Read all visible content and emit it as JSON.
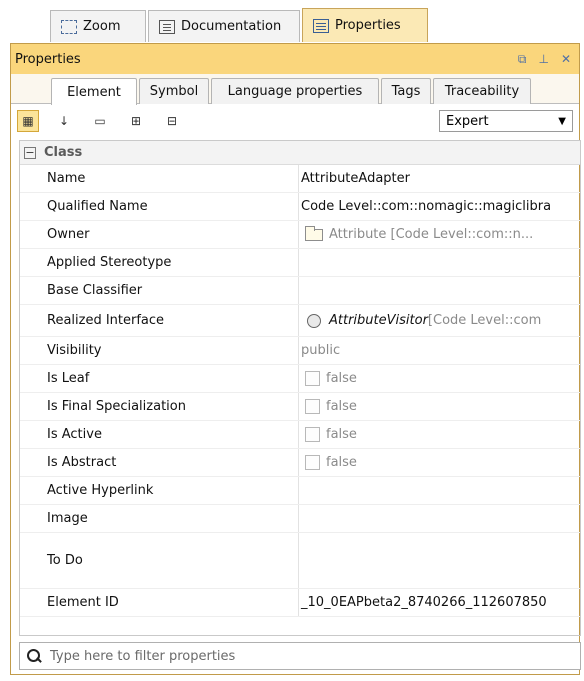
{
  "top_tabs": [
    {
      "label": "Zoom",
      "icon": "zoom-icon"
    },
    {
      "label": "Documentation",
      "icon": "documentation-icon"
    },
    {
      "label": "Properties",
      "icon": "properties-icon"
    }
  ],
  "panel": {
    "title": "Properties",
    "buttons": [
      "float-icon",
      "pin-icon",
      "close-icon"
    ]
  },
  "sub_tabs": [
    "Element",
    "Symbol",
    "Language properties",
    "Tags",
    "Traceability"
  ],
  "toolbar": {
    "mode": "Expert"
  },
  "group": {
    "label": "Class",
    "toggle": "⊟"
  },
  "rows": {
    "name": {
      "key": "Name",
      "value": "AttributeAdapter"
    },
    "qualified_name": {
      "key": "Qualified Name",
      "value": "Code Level::com::nomagic::magiclibra"
    },
    "owner": {
      "key": "Owner",
      "value": "Attribute [Code Level::com::n..."
    },
    "applied_stereotype": {
      "key": "Applied Stereotype",
      "value": ""
    },
    "base_classifier": {
      "key": "Base Classifier",
      "value": ""
    },
    "realized_interface": {
      "key": "Realized Interface",
      "value_name": "AttributeVisitor",
      "value_rest": " [Code Level::com"
    },
    "visibility": {
      "key": "Visibility",
      "value": "public"
    },
    "is_leaf": {
      "key": "Is Leaf",
      "value": "false"
    },
    "is_final_specialization": {
      "key": "Is Final Specialization",
      "value": "false"
    },
    "is_active": {
      "key": "Is Active",
      "value": "false"
    },
    "is_abstract": {
      "key": "Is Abstract",
      "value": "false"
    },
    "active_hyperlink": {
      "key": "Active Hyperlink",
      "value": ""
    },
    "image": {
      "key": "Image",
      "value": ""
    },
    "to_do": {
      "key": "To Do",
      "value": ""
    },
    "element_id": {
      "key": "Element ID",
      "value": "_10_0EAPbeta2_8740266_112607850"
    }
  },
  "filter": {
    "placeholder": "Type here to filter properties"
  }
}
